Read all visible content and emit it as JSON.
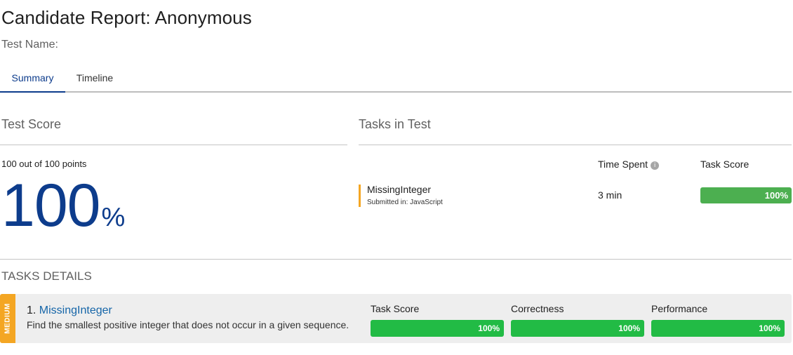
{
  "header": {
    "title": "Candidate Report: Anonymous",
    "test_name_label": "Test Name:"
  },
  "tabs": [
    {
      "label": "Summary",
      "active": true
    },
    {
      "label": "Timeline",
      "active": false
    }
  ],
  "test_score": {
    "section_title": "Test Score",
    "points_text": "100 out of 100 points",
    "score_value": "100",
    "score_unit": "%"
  },
  "tasks_in_test": {
    "section_title": "Tasks in Test",
    "col_time": "Time Spent",
    "col_score": "Task Score",
    "tasks": [
      {
        "name": "MissingInteger",
        "submitted": "Submitted in: JavaScript",
        "time": "3 min",
        "score_label": "100%",
        "score_fraction": 1.0
      }
    ]
  },
  "tasks_details": {
    "section_title": "TASKS DETAILS",
    "items": [
      {
        "difficulty": "MEDIUM",
        "number": "1.",
        "name": "MissingInteger",
        "description": "Find the smallest positive integer that does not occur in a given sequence.",
        "metrics": [
          {
            "label": "Task Score",
            "value": "100%",
            "fraction": 1.0
          },
          {
            "label": "Correctness",
            "value": "100%",
            "fraction": 1.0
          },
          {
            "label": "Performance",
            "value": "100%",
            "fraction": 1.0
          }
        ]
      }
    ]
  },
  "colors": {
    "accent_blue": "#0d3c8c",
    "link_blue": "#1565a8",
    "medium_orange": "#f4a623",
    "score_green": "#4caf50",
    "metric_green": "#22bb45"
  },
  "icons": {
    "time_info": "info-icon"
  }
}
